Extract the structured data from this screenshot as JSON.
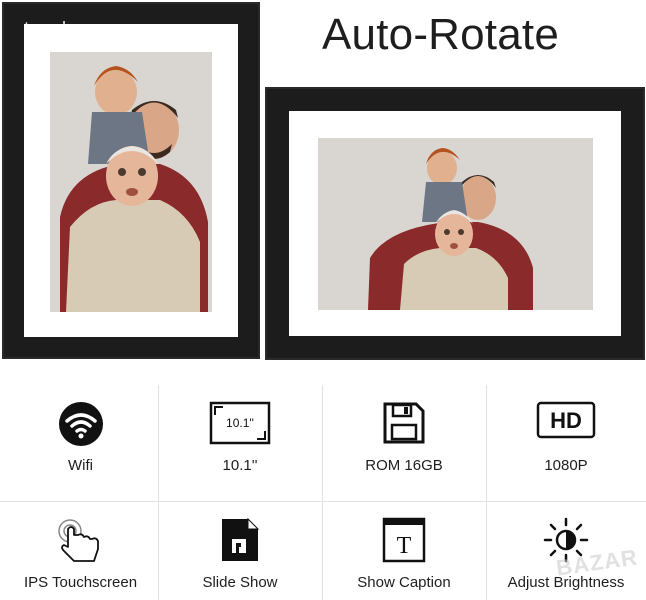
{
  "watermark": "topshop",
  "headline": "Auto-Rotate",
  "features": [
    {
      "label": "Wifi",
      "icon": "wifi-icon"
    },
    {
      "label": "10.1''",
      "icon": "screen-size-icon",
      "icon_text": "10.1''"
    },
    {
      "label": "ROM 16GB",
      "icon": "floppy-disk-icon"
    },
    {
      "label": "1080P",
      "icon": "hd-icon",
      "icon_text": "HD"
    },
    {
      "label": "IPS Touchscreen",
      "icon": "touch-hand-icon"
    },
    {
      "label": "Slide Show",
      "icon": "slideshow-file-icon"
    },
    {
      "label": "Show Caption",
      "icon": "caption-text-icon",
      "icon_text": "T"
    },
    {
      "label": "Adjust Brightness",
      "icon": "brightness-icon"
    }
  ],
  "corner_watermark": "BAZAR"
}
